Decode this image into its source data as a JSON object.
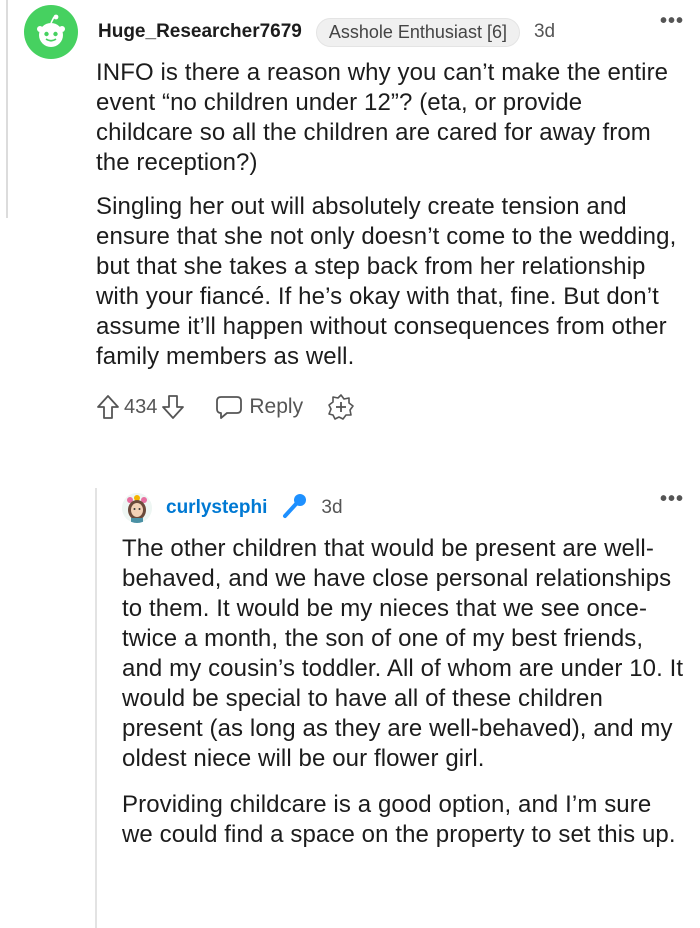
{
  "comment1": {
    "username": "Huge_Researcher7679",
    "flair": "Asshole Enthusiast [6]",
    "time": "3d",
    "paragraphs": [
      "INFO is there a reason why you can’t make the entire event “no children under 12”? (eta, or provide childcare so all the children are cared for away from the reception?)",
      "Singling her out will absolutely create tension and ensure that she not only doesn’t come to the wedding, but that she takes a step back from her relationship with your fiancé. If he’s okay with that, fine. But don’t assume it’ll happen without consequences from other family members as well."
    ],
    "votes": "434",
    "reply_label": "Reply"
  },
  "comment2": {
    "username": "curlystephi",
    "time": "3d",
    "paragraphs": [
      "The other children that would be present are well-behaved, and we have close personal relationships to them. It would be my nieces that we see once-twice a month, the son of one of my best friends, and my cousin’s toddler. All of whom are under 10. It would be special to have all of these children present (as long as they are well-behaved), and my oldest niece will be our flower girl.",
      "Providing childcare is a good option, and I’m sure we could find a space on the property to set this up."
    ]
  },
  "colors": {
    "avatar_green": "#46d160",
    "username_blue": "#0079d3",
    "mod_icon_blue": "#1e90ff",
    "meta_gray": "#555555"
  },
  "icons": [
    "snoo-avatar-icon",
    "more-options-icon",
    "upvote-icon",
    "downvote-icon",
    "comment-bubble-icon",
    "award-icon",
    "avatar-icon",
    "microphone-icon"
  ]
}
